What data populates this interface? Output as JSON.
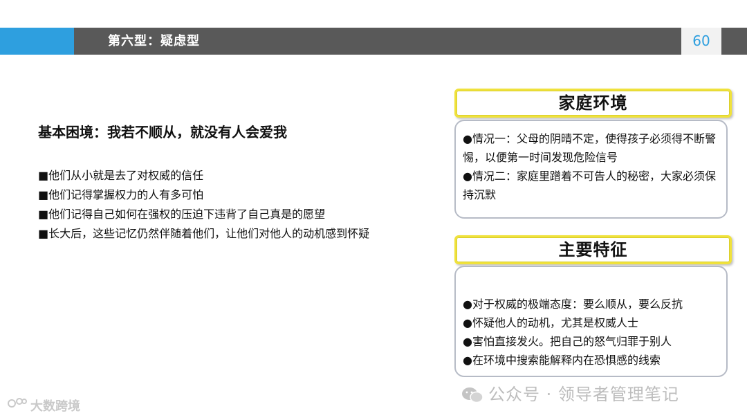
{
  "header": {
    "title": "第六型：疑虑型",
    "page_number": "60"
  },
  "left": {
    "dilemma": "基本困境：我若不顺从，就没有人会爱我",
    "bullets": [
      "■他们从小就是去了对权威的信任",
      "■他们记得掌握权力的人有多可怕",
      "■他们记得自己如何在强权的压迫下违背了自己真是的愿望",
      "■长大后，这些记忆仍然伴随着他们，让他们对他人的动机感到怀疑"
    ]
  },
  "family": {
    "heading": "家庭环境",
    "items": [
      "●情况一：父母的阴晴不定，使得孩子必须得不断警惕，以便第一时间发现危险信号",
      "●情况二：家庭里蹭着不可告人的秘密，大家必须保持沉默"
    ]
  },
  "traits": {
    "heading": "主要特征",
    "items": [
      "●对于权威的极端态度：要么顺从，要么反抗",
      "●怀疑他人的动机，尤其是权威人士",
      "●害怕直接发火。把自己的怒气归罪于别人",
      "●在环境中搜索能解释内在恐惧感的线索"
    ]
  },
  "footer": {
    "left_brand": "大数跨境",
    "watermark": "公众号 · 领导者管理笔记"
  },
  "colors": {
    "accent_blue": "#2e9fdf",
    "bar_gray": "#595959",
    "heading_border": "#f0e23c"
  }
}
